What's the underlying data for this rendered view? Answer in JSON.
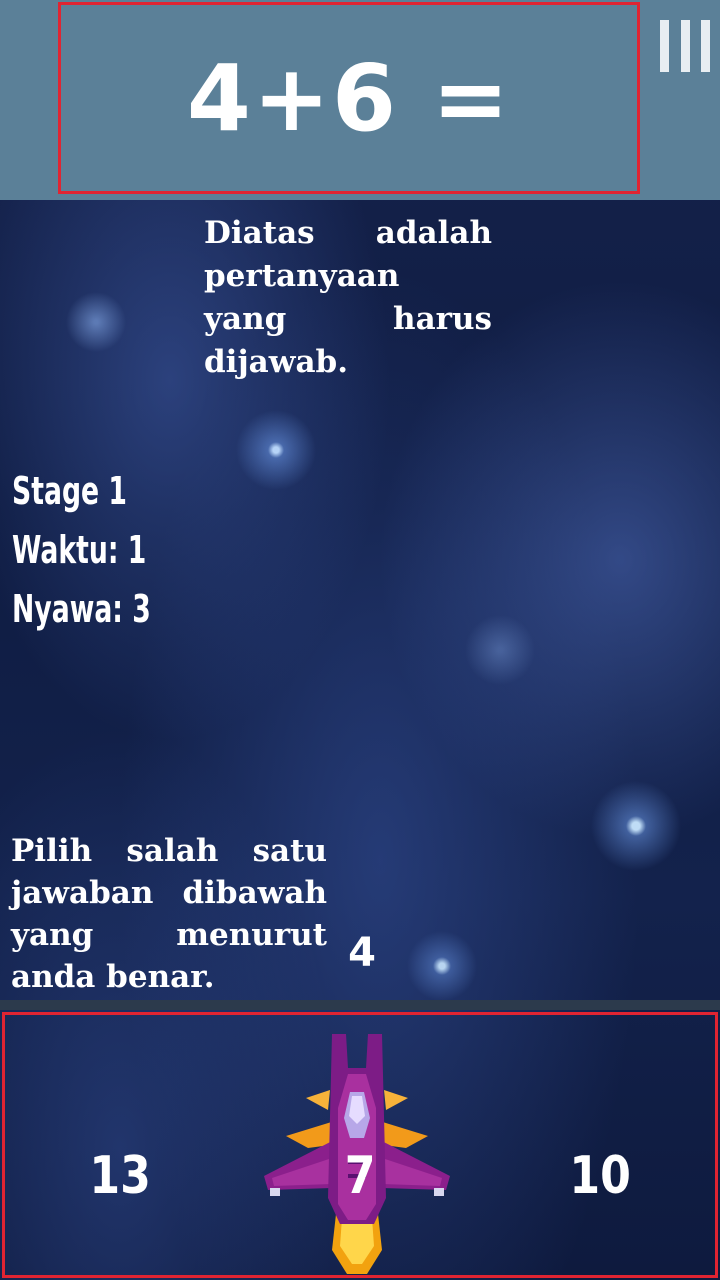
{
  "question": {
    "text": "4+6 ="
  },
  "menu": {
    "icon": "menu-bars-icon"
  },
  "hints": {
    "top": "Diatas adalah pertanyaan yang harus dijawab.",
    "bottom": "Pilih salah satu jawaban dibawah yang menurut anda benar."
  },
  "status": {
    "stage": "Stage 1",
    "time": "Waktu: 1",
    "lives": "Nyawa: 3"
  },
  "current_answer": "4",
  "options": [
    "13",
    "7",
    "10"
  ],
  "player": {
    "icon": "spaceship-icon"
  },
  "colors": {
    "header_bg": "#5b8098",
    "highlight_border": "#e02432",
    "text": "#ffffff"
  }
}
